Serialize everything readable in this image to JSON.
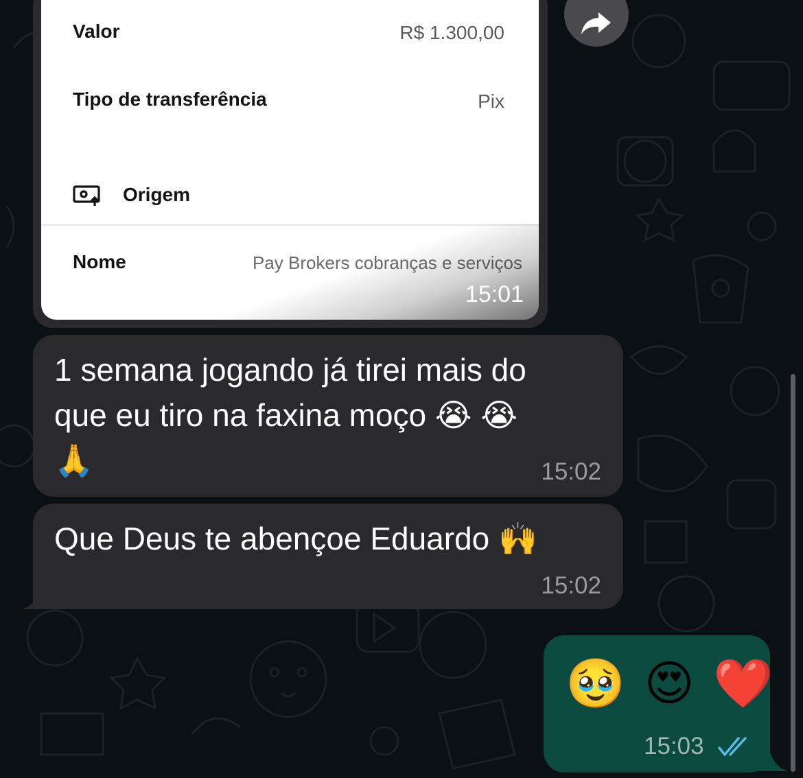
{
  "receipt": {
    "rows": [
      {
        "label": "Valor",
        "value": "R$ 1.300,00"
      },
      {
        "label": "Tipo de transferência",
        "value": "Pix"
      }
    ],
    "section_title": "Origem",
    "section_icon": "payment-source-icon",
    "name_label": "Nome",
    "name_value": "Pay Brokers cobranças e serviços"
  },
  "image_message": {
    "time": "15:01"
  },
  "messages": [
    {
      "lines": [
        "1 semana jogando já tirei mais do",
        "que eu tiro na faxina moço 😭 😭",
        "🙏"
      ],
      "time": "15:02"
    },
    {
      "lines": [
        "Que Deus te abençoe Eduardo 🙌"
      ],
      "time": "15:02"
    }
  ],
  "outgoing": {
    "emojis": "🥹 😍 ❤️",
    "time": "15:03",
    "status_icon": "double-check-read-icon"
  },
  "forward_icon": "forward-arrow-icon",
  "colors": {
    "background": "#0b1014",
    "incoming_bubble": "#2a2a2c",
    "outgoing_bubble": "#0b4a3f",
    "read_ticks": "#53bdeb"
  }
}
